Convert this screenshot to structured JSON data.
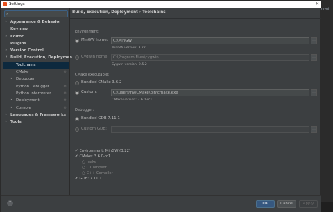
{
  "window": {
    "title": "Settings",
    "background_hint": "myqi"
  },
  "search": {
    "placeholder": ""
  },
  "tree": [
    {
      "label": "Appearance & Behavior",
      "level": 0,
      "arrow": "▸",
      "bold": true
    },
    {
      "label": "Keymap",
      "level": 0,
      "arrow": "",
      "bold": true
    },
    {
      "label": "Editor",
      "level": 0,
      "arrow": "▸",
      "bold": true
    },
    {
      "label": "Plugins",
      "level": 0,
      "arrow": "",
      "bold": true
    },
    {
      "label": "Version Control",
      "level": 0,
      "arrow": "▸",
      "bold": true
    },
    {
      "label": "Build, Execution, Deployment",
      "level": 0,
      "arrow": "▾",
      "bold": true
    },
    {
      "label": "Toolchains",
      "level": 1,
      "arrow": "",
      "selected": true
    },
    {
      "label": "CMake",
      "level": 1,
      "arrow": "",
      "gear": true
    },
    {
      "label": "Debugger",
      "level": 1,
      "arrow": "▸"
    },
    {
      "label": "Python Debugger",
      "level": 1,
      "arrow": "",
      "gear": true
    },
    {
      "label": "Python Interpreter",
      "level": 1,
      "arrow": "",
      "gear": true
    },
    {
      "label": "Deployment",
      "level": 1,
      "arrow": "▸",
      "gear": true
    },
    {
      "label": "Console",
      "level": 1,
      "arrow": "▸",
      "gear": true
    },
    {
      "label": "Languages & Frameworks",
      "level": 0,
      "arrow": "▸",
      "bold": true
    },
    {
      "label": "Tools",
      "level": 0,
      "arrow": "▸",
      "bold": true
    }
  ],
  "breadcrumb": "Build, Execution, Deployment › Toolchains",
  "environment": {
    "section": "Environment:",
    "mingw": {
      "label": "MinGW home:",
      "value": "C:\\MinGW",
      "note": "MinGW version: 3.22",
      "selected": true
    },
    "cygwin": {
      "label": "Cygwin home:",
      "value": "C:\\Program Files\\cygwin",
      "note": "Cygwin version: 2.5.2",
      "selected": false
    }
  },
  "cmake": {
    "section": "CMake executable:",
    "bundled": {
      "label": "Bundled CMake 3.6.2",
      "selected": false
    },
    "custom": {
      "label": "Custom:",
      "value": "C:\\Users\\hy\\CMake\\bin\\cmake.exe",
      "note": "CMake version: 3.6.0-rc1",
      "selected": true
    }
  },
  "debugger": {
    "section": "Debugger:",
    "bundled": {
      "label": "Bundled GDB 7.11.1",
      "selected": true
    },
    "custom": {
      "label": "Custom GDB:",
      "value": "",
      "selected": false
    }
  },
  "checks": [
    {
      "mark": "✔",
      "label": "Environment: MinGW (3.22)",
      "sub": false
    },
    {
      "mark": "✔",
      "label": "CMake: 3.6.0-rc1",
      "sub": false
    },
    {
      "mark": "◌",
      "label": "make",
      "sub": true
    },
    {
      "mark": "◌",
      "label": "C Compiler",
      "sub": true
    },
    {
      "mark": "◌",
      "label": "C++ Compiler",
      "sub": true
    },
    {
      "mark": "✔",
      "label": "GDB: 7.11.1",
      "sub": false
    }
  ],
  "buttons": {
    "help": "?",
    "ok": "OK",
    "cancel": "Cancel",
    "apply": "Apply"
  },
  "colors": {
    "selection": "#0d293e",
    "ok_button": "#365880",
    "panel": "#3c3f41"
  }
}
